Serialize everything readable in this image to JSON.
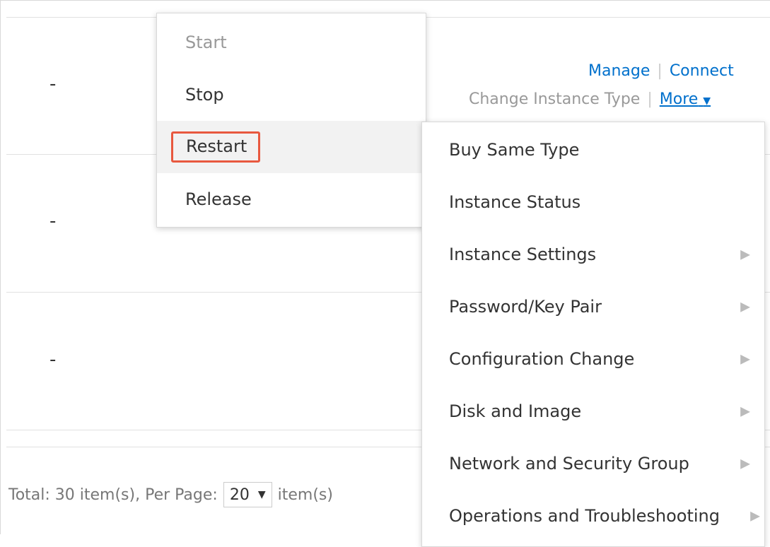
{
  "table": {
    "rows": [
      {
        "cell": "-"
      },
      {
        "cell": "-"
      },
      {
        "cell": "-"
      }
    ]
  },
  "actions": {
    "manage": "Manage",
    "connect": "Connect",
    "separator": "|",
    "change_instance_type": "Change Instance Type",
    "more": "More"
  },
  "state_menu": {
    "items": [
      {
        "label": "Start",
        "disabled": true
      },
      {
        "label": "Stop"
      },
      {
        "label": "Restart",
        "highlighted": true
      },
      {
        "label": "Release"
      }
    ]
  },
  "more_menu": {
    "items": [
      {
        "label": "Buy Same Type"
      },
      {
        "label": "Instance Status"
      },
      {
        "label": "Instance Settings",
        "submenu": true
      },
      {
        "label": "Password/Key Pair",
        "submenu": true
      },
      {
        "label": "Configuration Change",
        "submenu": true
      },
      {
        "label": "Disk and Image",
        "submenu": true
      },
      {
        "label": "Network and Security Group",
        "submenu": true
      },
      {
        "label": "Operations and Troubleshooting",
        "submenu": true
      }
    ]
  },
  "pagination": {
    "total_text": "Total: 30 item(s), Per Page:",
    "per_page": "20",
    "suffix": "item(s)"
  },
  "colors": {
    "link": "#0070cc",
    "highlight_border": "#e8583f"
  }
}
